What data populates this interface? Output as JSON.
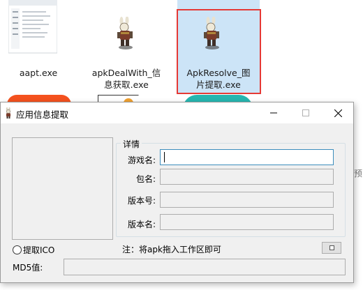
{
  "explorer": {
    "files": [
      {
        "name_line1": "aapt.exe",
        "name_line2": ""
      },
      {
        "name_line1": "apkDealWith_信",
        "name_line2": "息获取.exe"
      },
      {
        "name_line1": "ApkResolve_图",
        "name_line2": "片提取.exe"
      }
    ],
    "clipped_side_text": "看预"
  },
  "window": {
    "title": "应用信息提取",
    "group_title": "详情",
    "fields": [
      {
        "label": "游戏名:",
        "value": ""
      },
      {
        "label": "包名:",
        "value": ""
      },
      {
        "label": "版本号:",
        "value": ""
      },
      {
        "label": "版本名:",
        "value": ""
      }
    ],
    "radio_label": "提取ICO",
    "note": "注：将apk拖入工作区即可",
    "md5_label": "MD5值:",
    "md5_value": ""
  },
  "colors": {
    "selection_box": "#e53935",
    "selection_fill": "#cce4f7",
    "window_bg": "#f0f0f0",
    "focus_border": "#3c8dbc"
  }
}
